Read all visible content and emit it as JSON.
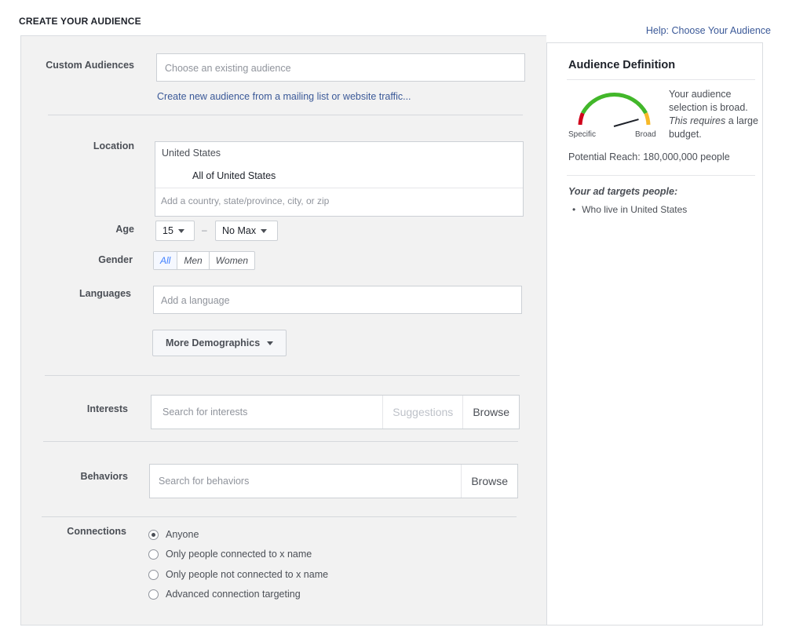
{
  "page": {
    "title": "CREATE YOUR AUDIENCE",
    "help_link": "Help: Choose Your Audience"
  },
  "custom_audiences": {
    "label": "Custom Audiences",
    "placeholder": "Choose an existing audience",
    "create_link": "Create new audience from a mailing list or website traffic..."
  },
  "location": {
    "label": "Location",
    "country": "United States",
    "scope": "All of United States",
    "placeholder": "Add a country, state/province, city, or zip"
  },
  "age": {
    "label": "Age",
    "min": "15",
    "separator": "–",
    "max": "No Max"
  },
  "gender": {
    "label": "Gender",
    "options": [
      "All",
      "Men",
      "Women"
    ],
    "selected": "All"
  },
  "languages": {
    "label": "Languages",
    "placeholder": "Add a language"
  },
  "more_demographics": "More Demographics",
  "interests": {
    "label": "Interests",
    "placeholder": "Search for interests",
    "suggestions": "Suggestions",
    "browse": "Browse"
  },
  "behaviors": {
    "label": "Behaviors",
    "placeholder": "Search for behaviors",
    "browse": "Browse"
  },
  "connections": {
    "label": "Connections",
    "options": [
      "Anyone",
      "Only people connected to x name",
      "Only people not connected to x name",
      "Advanced connection targeting"
    ],
    "selected_index": 0
  },
  "audience_definition": {
    "title": "Audience Definition",
    "gauge_left": "Specific",
    "gauge_right": "Broad",
    "gauge_level": 0.85,
    "desc_line1": "Your audience selection is broad.",
    "desc_line2_em": "This requires",
    "desc_line2_rest": " a large budget.",
    "reach": "Potential Reach: 180,000,000 people",
    "targets_title": "Your ad targets people:",
    "targets": [
      "Who live in United States"
    ],
    "colors": {
      "specific": "#d0021b",
      "mid": "#42b72a",
      "broad": "#f7b928"
    }
  }
}
